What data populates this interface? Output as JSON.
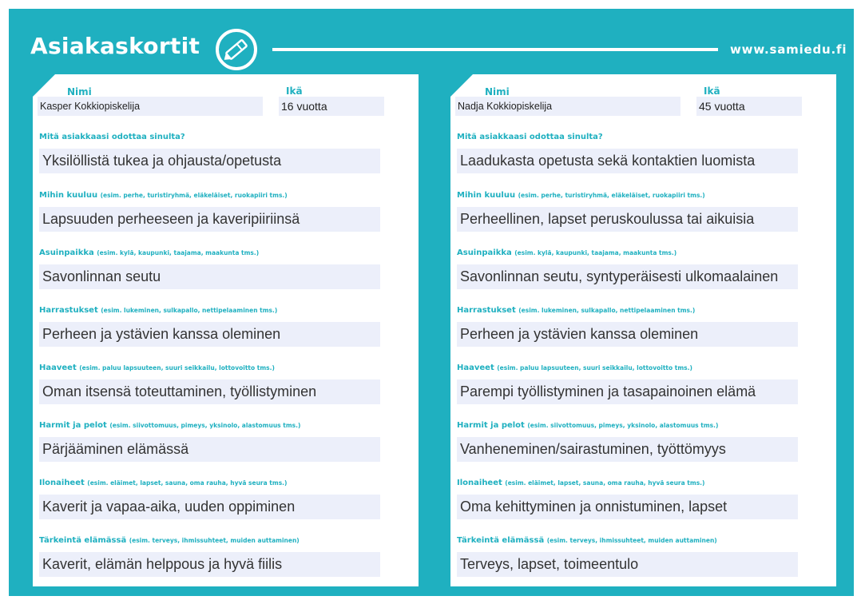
{
  "header": {
    "title": "Asiakaskortit",
    "url": "www.samiedu.fi"
  },
  "colors": {
    "brand": "#1fb0c0",
    "field_bg": "#eceffa",
    "card_bg": "#ffffff"
  },
  "icons": {
    "logo": "pencil-circle-icon"
  },
  "labels": {
    "name": "Nimi",
    "age": "Ikä",
    "q0": "Mitä asiakkaasi odottaa sinulta?",
    "q1": "Mihin kuuluu",
    "q1_hint": "(esim. perhe, turistiryhmä, eläkeläiset, ruokapiiri tms.)",
    "q2": "Asuinpaikka",
    "q2_hint": "(esim. kylä, kaupunki, taajama, maakunta tms.)",
    "q3": "Harrastukset",
    "q3_hint": "(esim. lukeminen, sulkapallo, nettipelaaminen tms.)",
    "q4": "Haaveet",
    "q4_hint": "(esim. paluu lapsuuteen, suuri seikkailu, lottovoitto tms.)",
    "q5": "Harmit ja pelot",
    "q5_hint": "(esim. siivottomuus, pimeys, yksinolo, alastomuus tms.)",
    "q6": "Ilonaiheet",
    "q6_hint": "(esim. eläimet, lapset, sauna, oma rauha, hyvä seura tms.)",
    "q7": "Tärkeintä elämässä",
    "q7_hint": "(esim. terveys, ihmissuhteet, muiden auttaminen)"
  },
  "cards": [
    {
      "name": "Kasper Kokkiopiskelija",
      "age": "16 vuotta",
      "answers": [
        "Yksilöllistä tukea ja ohjausta/opetusta",
        "Lapsuuden perheeseen ja kaveripiiriinsä",
        "Savonlinnan seutu",
        "Perheen ja ystävien kanssa oleminen",
        "Oman itsensä toteuttaminen, työllistyminen",
        "Pärjääminen elämässä",
        "Kaverit ja vapaa-aika, uuden oppiminen",
        "Kaverit, elämän helppous ja hyvä fiilis"
      ]
    },
    {
      "name": "Nadja Kokkiopiskelija",
      "age": "45 vuotta",
      "answers": [
        "Laadukasta opetusta sekä kontaktien luomista",
        "Perheellinen, lapset peruskoulussa tai aikuisia",
        "Savonlinnan seutu, syntyperäisesti ulkomaalainen",
        "Perheen ja ystävien kanssa oleminen",
        "Parempi työllistyminen ja tasapainoinen elämä",
        "Vanheneminen/sairastuminen, työttömyys",
        "Oma kehittyminen ja onnistuminen, lapset",
        "Terveys, lapset, toimeentulo"
      ]
    }
  ]
}
